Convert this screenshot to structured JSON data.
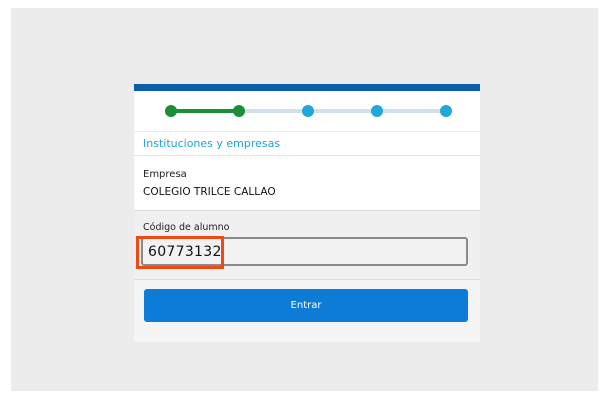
{
  "stepper": {
    "steps": 5,
    "completed": 2,
    "colors": {
      "done": "#1a8f36",
      "pending": "#22a7da",
      "track": "#d3e0ea"
    }
  },
  "section": {
    "title": "Instituciones y empresas"
  },
  "company": {
    "label": "Empresa",
    "value": "COLEGIO TRILCE CALLAO"
  },
  "student_code": {
    "label": "Código de alumno",
    "value": "60773132"
  },
  "submit": {
    "label": "Entrar"
  },
  "colors": {
    "top_bar": "#0c5fa8",
    "button": "#0d7cd6",
    "highlight": "#ee4a16",
    "section_text": "#1fa2d6"
  }
}
